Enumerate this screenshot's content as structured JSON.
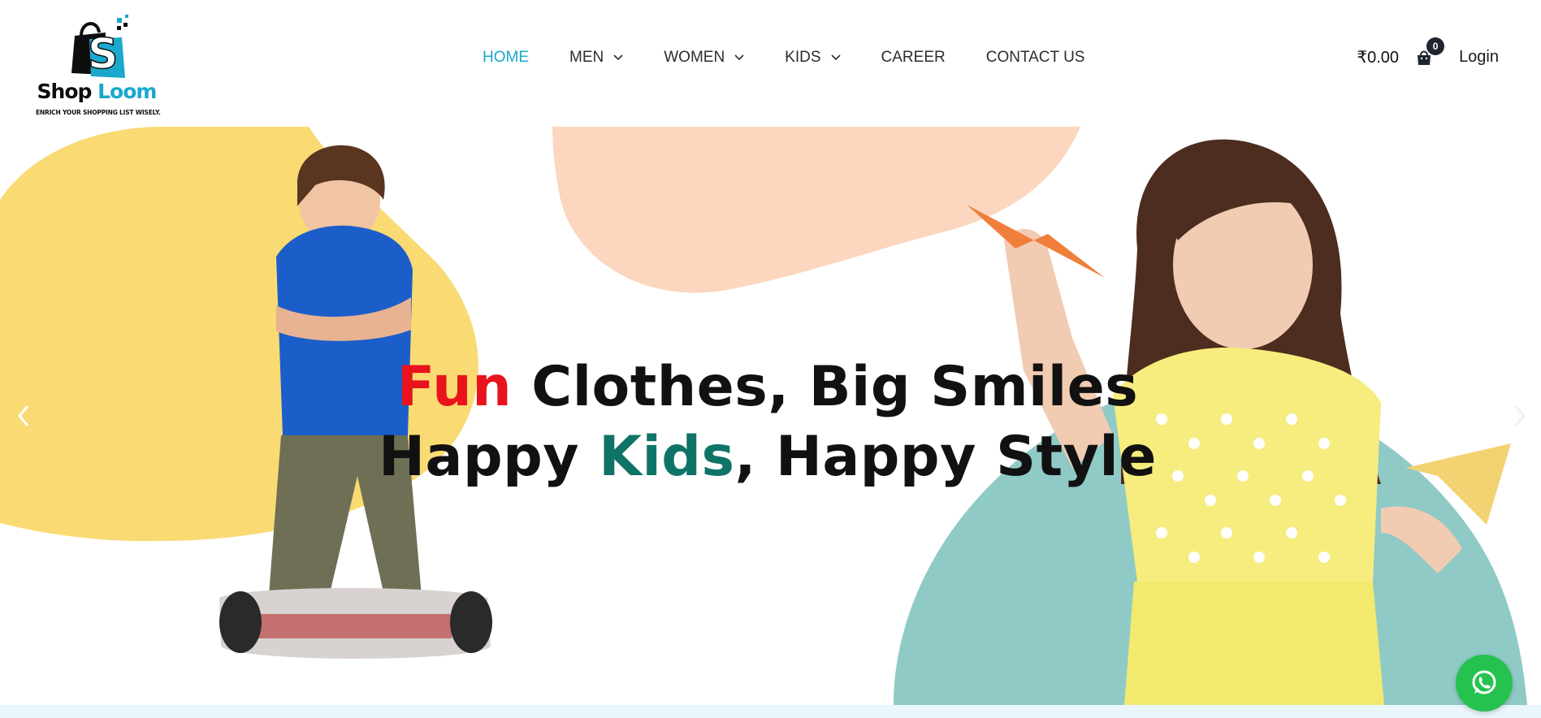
{
  "brand": {
    "name_part1": "Shop",
    "name_part2": "Loom",
    "tagline": "ENRICH YOUR SHOPPING LIST WISELY.",
    "logo_letter": "S",
    "colors": {
      "accent": "#1aa8cc",
      "dark": "#0e0e0e"
    }
  },
  "nav": {
    "items": [
      {
        "label": "HOME",
        "active": true,
        "has_dropdown": false
      },
      {
        "label": "MEN",
        "active": false,
        "has_dropdown": true
      },
      {
        "label": "WOMEN",
        "active": false,
        "has_dropdown": true
      },
      {
        "label": "KIDS",
        "active": false,
        "has_dropdown": true
      },
      {
        "label": "CAREER",
        "active": false,
        "has_dropdown": false
      },
      {
        "label": "CONTACT US",
        "active": false,
        "has_dropdown": false
      }
    ],
    "active_color": "#1aa8cc",
    "text_color": "#2c2c34"
  },
  "header_right": {
    "cart_total": "₹0.00",
    "cart_count": "0",
    "cart_icon": "shopping-bag-icon",
    "login_label": "Login"
  },
  "hero": {
    "line1": {
      "highlight": "Fun",
      "rest": " Clothes, Big Smiles"
    },
    "line2": {
      "before": "Happy ",
      "highlight": "Kids",
      "after": ", Happy Style"
    },
    "highlight_colors": {
      "fun": "#e8131b",
      "kids": "#0f7468"
    },
    "blob_colors": {
      "yellow": "#f9da73",
      "peach": "#fdd6bf",
      "teal": "#8fcac6",
      "girl_shirt": "#f7ec7e"
    },
    "prev_icon": "chevron-left-icon",
    "next_icon": "chevron-right-icon"
  },
  "whatsapp": {
    "icon": "whatsapp-icon",
    "color": "#25c24f"
  }
}
